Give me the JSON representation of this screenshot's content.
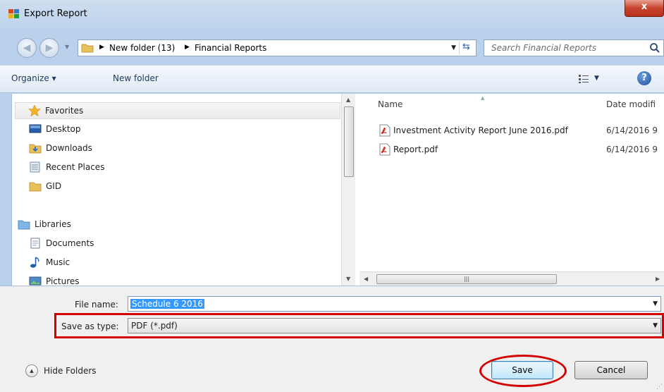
{
  "window": {
    "title": "Export Report",
    "close_label": "x"
  },
  "address": {
    "crumbs": [
      "New folder (13)",
      "Financial Reports"
    ],
    "search_placeholder": "Search Financial Reports"
  },
  "toolbar": {
    "organize_label": "Organize ▾",
    "new_folder_label": "New folder",
    "help_label": "?"
  },
  "nav": {
    "favorites_header": "Favorites",
    "favorites": [
      "Desktop",
      "Downloads",
      "Recent Places",
      "GID"
    ],
    "libraries_header": "Libraries",
    "libraries": [
      "Documents",
      "Music",
      "Pictures"
    ]
  },
  "files": {
    "columns": [
      "Name",
      "Date modifi"
    ],
    "rows": [
      {
        "name": "Investment Activity Report June 2016.pdf",
        "date": "6/14/2016 9"
      },
      {
        "name": "Report.pdf",
        "date": "6/14/2016 9"
      }
    ]
  },
  "form": {
    "file_name_label": "File name:",
    "file_name_value": "Schedule 6 2016",
    "save_type_label": "Save as type:",
    "save_type_value": "PDF (*.pdf)"
  },
  "footer": {
    "hide_folders_label": "Hide Folders",
    "save_label": "Save",
    "cancel_label": "Cancel"
  },
  "colors": {
    "highlight": "#d40000",
    "selection": "#3399ff"
  }
}
